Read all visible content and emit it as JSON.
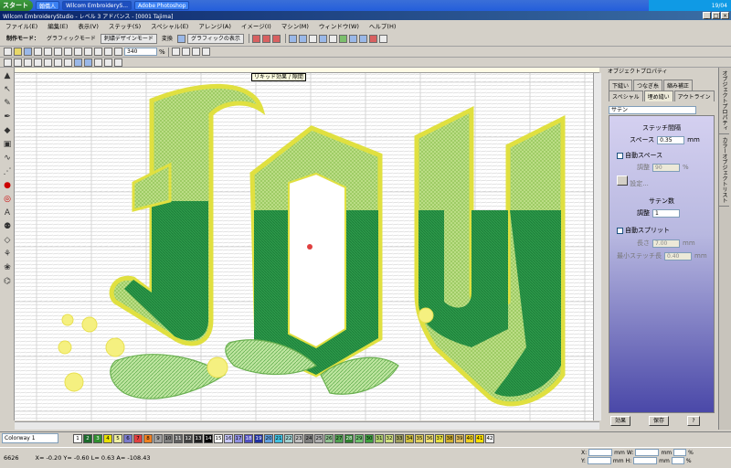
{
  "taskbar": {
    "start": "スタート",
    "buttons": [
      "翰僑人",
      "Wilcom EmbroideryS...",
      "Adobe Photoshop"
    ],
    "tray": [
      "19/04"
    ]
  },
  "title": "Wilcom EmbroideryStudio - レベル 3 アドバンス - [0001     Tajima]",
  "menu": [
    "ファイル(E)",
    "編集(E)",
    "表示(V)",
    "ステッチ(S)",
    "スペシャル(E)",
    "アレンジ(A)",
    "イメージ(I)",
    "マシン(M)",
    "ウィンドウ(W)",
    "ヘルプ(H)"
  ],
  "toolbar1": {
    "mode_label": "制作モード：",
    "graphic_mode": "グラフィックモード",
    "embroidery_mode": "刺繍デザインモード",
    "convert": "変換",
    "show_graphics": "グラフィックの表示"
  },
  "toolbar2": {
    "zoom": "340",
    "zoom_unit": "%"
  },
  "tooltip": "リキッド効果 / 隙間",
  "panel": {
    "header": "オブジェクトプロパティ",
    "tabs_row1": [
      "下縫い",
      "つなぎ糸",
      "縮み補正"
    ],
    "tabs_row2": [
      "スペシャル",
      "埋め縫い",
      "アウトライン"
    ],
    "stitch_type": "サテン",
    "stitch_spacing_title": "ステッチ間隔",
    "space_label": "スペース",
    "space_value": "0.35",
    "unit_mm": "mm",
    "auto_space": "自動スペース",
    "adjust_label": "調整",
    "adjust_value": "90",
    "unit_pct": "%",
    "settings_btn": "設定...",
    "satin_title": "サテン数",
    "satin_adjust_label": "調整",
    "satin_adjust_value": "1",
    "auto_split": "自動スプリット",
    "length_label": "長さ",
    "length_value": "7.00",
    "min_stitch_label": "最小ステッチ長",
    "min_stitch_value": "0.40",
    "apply_btn": "効果",
    "save_btn": "保存",
    "help_btn": "?"
  },
  "vtabs": [
    "オブジェクトプロパティ",
    "カラーオブジェクトリスト"
  ],
  "colorway": "Colorway 1",
  "swatches": [
    {
      "n": "1",
      "c": "#ffffff"
    },
    {
      "n": "2",
      "c": "#1a6a2a"
    },
    {
      "n": "3",
      "c": "#2f8f2f"
    },
    {
      "n": "4",
      "c": "#e8e000"
    },
    {
      "n": "5",
      "c": "#f0f0a0"
    },
    {
      "n": "6",
      "c": "#7a7acc"
    },
    {
      "n": "7",
      "c": "#e04040"
    },
    {
      "n": "8",
      "c": "#f08020"
    },
    {
      "n": "9",
      "c": "#a0a0a0"
    },
    {
      "n": "10",
      "c": "#808080"
    },
    {
      "n": "11",
      "c": "#606060"
    },
    {
      "n": "12",
      "c": "#404040"
    },
    {
      "n": "13",
      "c": "#202020"
    },
    {
      "n": "14",
      "c": "#000000"
    },
    {
      "n": "15",
      "c": "#ffffff"
    },
    {
      "n": "16",
      "c": "#c8c8ff"
    },
    {
      "n": "17",
      "c": "#9090e0"
    },
    {
      "n": "18",
      "c": "#5050c0"
    },
    {
      "n": "19",
      "c": "#2030a0"
    },
    {
      "n": "20",
      "c": "#60a0e0"
    },
    {
      "n": "21",
      "c": "#40c0e0"
    },
    {
      "n": "22",
      "c": "#a0d0d0"
    },
    {
      "n": "23",
      "c": "#c0c0c0"
    },
    {
      "n": "24",
      "c": "#808080"
    },
    {
      "n": "25",
      "c": "#b0b0b0"
    },
    {
      "n": "26",
      "c": "#90c090"
    },
    {
      "n": "27",
      "c": "#50a050"
    },
    {
      "n": "28",
      "c": "#308030"
    },
    {
      "n": "29",
      "c": "#70c070"
    },
    {
      "n": "30",
      "c": "#40a040"
    },
    {
      "n": "31",
      "c": "#b0d070"
    },
    {
      "n": "32",
      "c": "#d0e080"
    },
    {
      "n": "33",
      "c": "#a0a060"
    },
    {
      "n": "34",
      "c": "#d0c040"
    },
    {
      "n": "35",
      "c": "#e0d060"
    },
    {
      "n": "36",
      "c": "#f0e070"
    },
    {
      "n": "37",
      "c": "#e8e040"
    },
    {
      "n": "38",
      "c": "#d0b030"
    },
    {
      "n": "39",
      "c": "#e0c060"
    },
    {
      "n": "40",
      "c": "#f0d020"
    },
    {
      "n": "41",
      "c": "#ffe000"
    },
    {
      "n": "42",
      "c": "#f0f0f0"
    }
  ],
  "status": {
    "stitches": "6626",
    "pos": "X= -0.20  Y= -0.60  L= 0.63  A= -108.43"
  },
  "coords": {
    "x_label": "X:",
    "y_label": "Y:",
    "w_label": "W:",
    "h_label": "H:",
    "unit": "mm",
    "pct": "%"
  }
}
